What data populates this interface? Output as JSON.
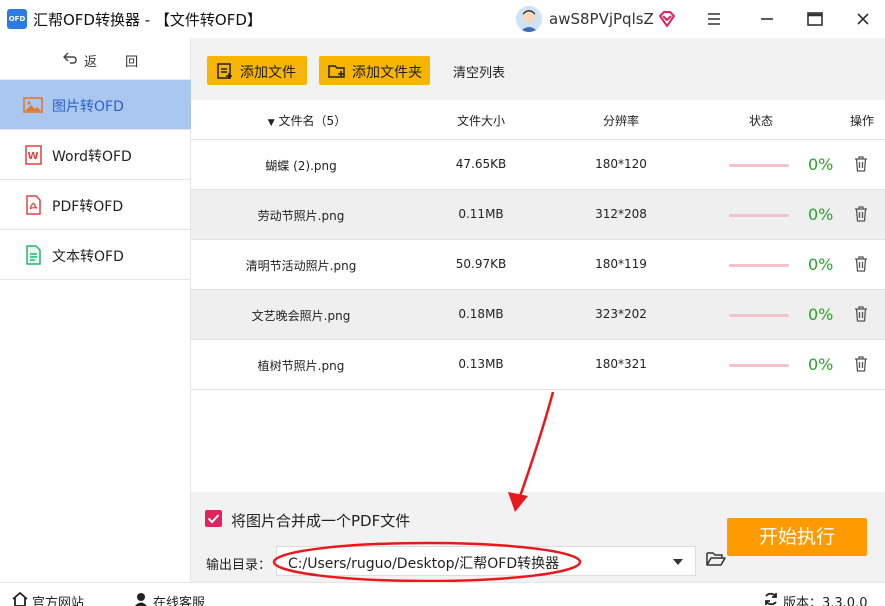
{
  "window": {
    "app_logo_text": "OFD",
    "title": "汇帮OFD转换器 - 【文件转OFD】",
    "username": "awS8PVjPqlsZ"
  },
  "sidebar": {
    "back_label": "返 回",
    "items": [
      {
        "label": "图片转OFD",
        "icon": "image-icon",
        "active": true
      },
      {
        "label": "Word转OFD",
        "icon": "word-icon",
        "active": false
      },
      {
        "label": "PDF转OFD",
        "icon": "pdf-icon",
        "active": false
      },
      {
        "label": "文本转OFD",
        "icon": "text-file-icon",
        "active": false
      }
    ]
  },
  "toolbar": {
    "add_file": "添加文件",
    "add_folder": "添加文件夹",
    "clear_list": "清空列表"
  },
  "table": {
    "headers": {
      "name": "文件名（5）",
      "size": "文件大小",
      "resolution": "分辨率",
      "status": "状态",
      "action": "操作"
    },
    "rows": [
      {
        "name": "蝴蝶 (2).png",
        "size": "47.65KB",
        "resolution": "180*120",
        "progress": 0,
        "percent": "0%"
      },
      {
        "name": "劳动节照片.png",
        "size": "0.11MB",
        "resolution": "312*208",
        "progress": 0,
        "percent": "0%"
      },
      {
        "name": "清明节活动照片.png",
        "size": "50.97KB",
        "resolution": "180*119",
        "progress": 0,
        "percent": "0%"
      },
      {
        "name": "文艺晚会照片.png",
        "size": "0.18MB",
        "resolution": "323*202",
        "progress": 0,
        "percent": "0%"
      },
      {
        "name": "植树节照片.png",
        "size": "0.13MB",
        "resolution": "180*321",
        "progress": 0,
        "percent": "0%"
      }
    ]
  },
  "bottom": {
    "merge_checked": true,
    "merge_label": "将图片合并成一个PDF文件",
    "output_label": "输出目录：",
    "output_path": "C:/Users/ruguo/Desktop/汇帮OFD转换器",
    "start_button": "开始执行"
  },
  "statusbar": {
    "website": "官方网站",
    "support": "在线客服",
    "version": "版本：3.3.0.0"
  },
  "colors": {
    "accent_yellow": "#f7b500",
    "start_orange": "#ff9a00",
    "active_nav_bg": "#a9c7ef",
    "active_nav_text": "#2b5fd1",
    "percent_green": "#2aa32a",
    "checkbox_red": "#e0245e",
    "annotation_red": "#e8191d"
  }
}
